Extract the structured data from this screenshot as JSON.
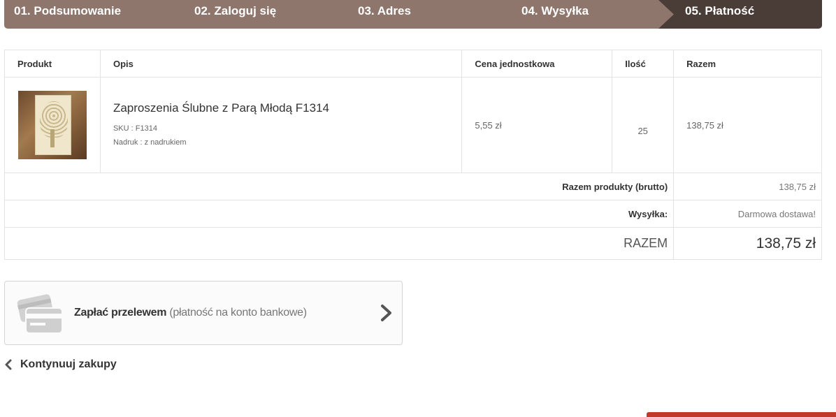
{
  "steps": [
    {
      "label": "01. Podsumowanie"
    },
    {
      "label": "02. Zaloguj się"
    },
    {
      "label": "03. Adres"
    },
    {
      "label": "04. Wysyłka"
    },
    {
      "label": "05. Płatność"
    }
  ],
  "table": {
    "headers": {
      "product": "Produkt",
      "description": "Opis",
      "unit_price": "Cena jednostkowa",
      "quantity": "Ilość",
      "total": "Razem"
    },
    "item": {
      "name": "Zaproszenia Ślubne z Parą Młodą F1314",
      "sku": "SKU : F1314",
      "print": "Nadruk : z nadrukiem",
      "unit_price": "5,55 zł",
      "quantity": "25",
      "total": "138,75 zł"
    },
    "summary": {
      "products_label": "Razem produkty (brutto)",
      "products_value": "138,75 zł",
      "shipping_label": "Wysyłka:",
      "shipping_value": "Darmowa dostawa!",
      "grand_label": "RAZEM",
      "grand_value": "138,75 zł"
    }
  },
  "payment": {
    "title": "Zapłać przelewem",
    "subtitle": "(płatność na konto bankowe)",
    "icon": "credit-card-icon"
  },
  "continue_label": "Kontynuuj zakupy",
  "colors": {
    "steps_bg": "#8f766d",
    "steps_active": "#4a3c37",
    "accent_red": "#c0392b"
  }
}
